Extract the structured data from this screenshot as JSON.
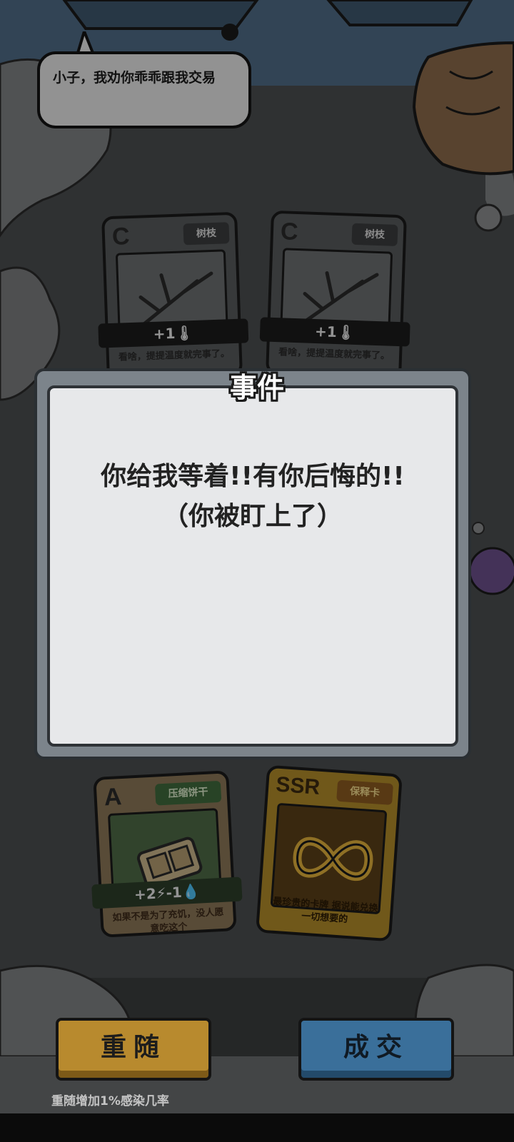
{
  "npc": {
    "speech": "小子，我劝你乖乖跟我交易"
  },
  "offer_cards": [
    {
      "grade": "C",
      "name": "树枝",
      "stat": "+1🌡",
      "desc": "看啥，提提温度就完事了。"
    },
    {
      "grade": "C",
      "name": "树枝",
      "stat": "+1🌡",
      "desc": "看啥，提提温度就完事了。"
    }
  ],
  "player_cards": [
    {
      "grade": "A",
      "name": "压缩饼干",
      "stat": "+2⚡-1💧",
      "desc": "如果不是为了充饥，没人愿意吃这个"
    },
    {
      "grade": "SSR",
      "name": "保释卡",
      "desc": "最珍贵的卡牌 据说能兑换一切想要的"
    }
  ],
  "dialog": {
    "title": "事件",
    "message_line1": "你给我等着!!有你后悔的!!",
    "message_line2": "（你被盯上了）"
  },
  "actions": {
    "reroll_label": "重随",
    "deal_label": "成交",
    "reroll_hint": "重随增加1%感染几率"
  },
  "colors": {
    "background": "#3b3d3e",
    "reroll_button": "#b88a2e",
    "deal_button": "#3a6f9a",
    "dialog_panel": "#e7e8ea",
    "dialog_frame": "#7c848b"
  }
}
